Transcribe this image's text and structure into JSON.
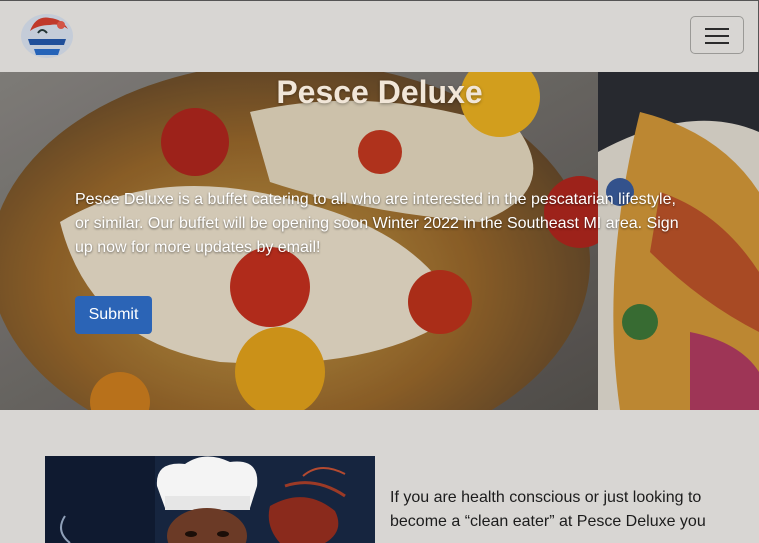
{
  "navbar": {
    "logo_alt": "Off the Hook logo",
    "toggle_label": "Toggle navigation"
  },
  "hero": {
    "title": "Pesce Deluxe",
    "description": "Pesce Deluxe is a buffet catering to all who are interested in the pescatarian lifestyle, or similar. Our buffet will be opening soon Winter 2022 in the Southeast MI area. Sign up now for more updates by email!",
    "submit_label": "Submit"
  },
  "about": {
    "text": "If you are health conscious or just looking to become a “clean eater” at Pesce Deluxe you"
  },
  "colors": {
    "background": "#d8d6d3",
    "button": "#2b64b6"
  }
}
